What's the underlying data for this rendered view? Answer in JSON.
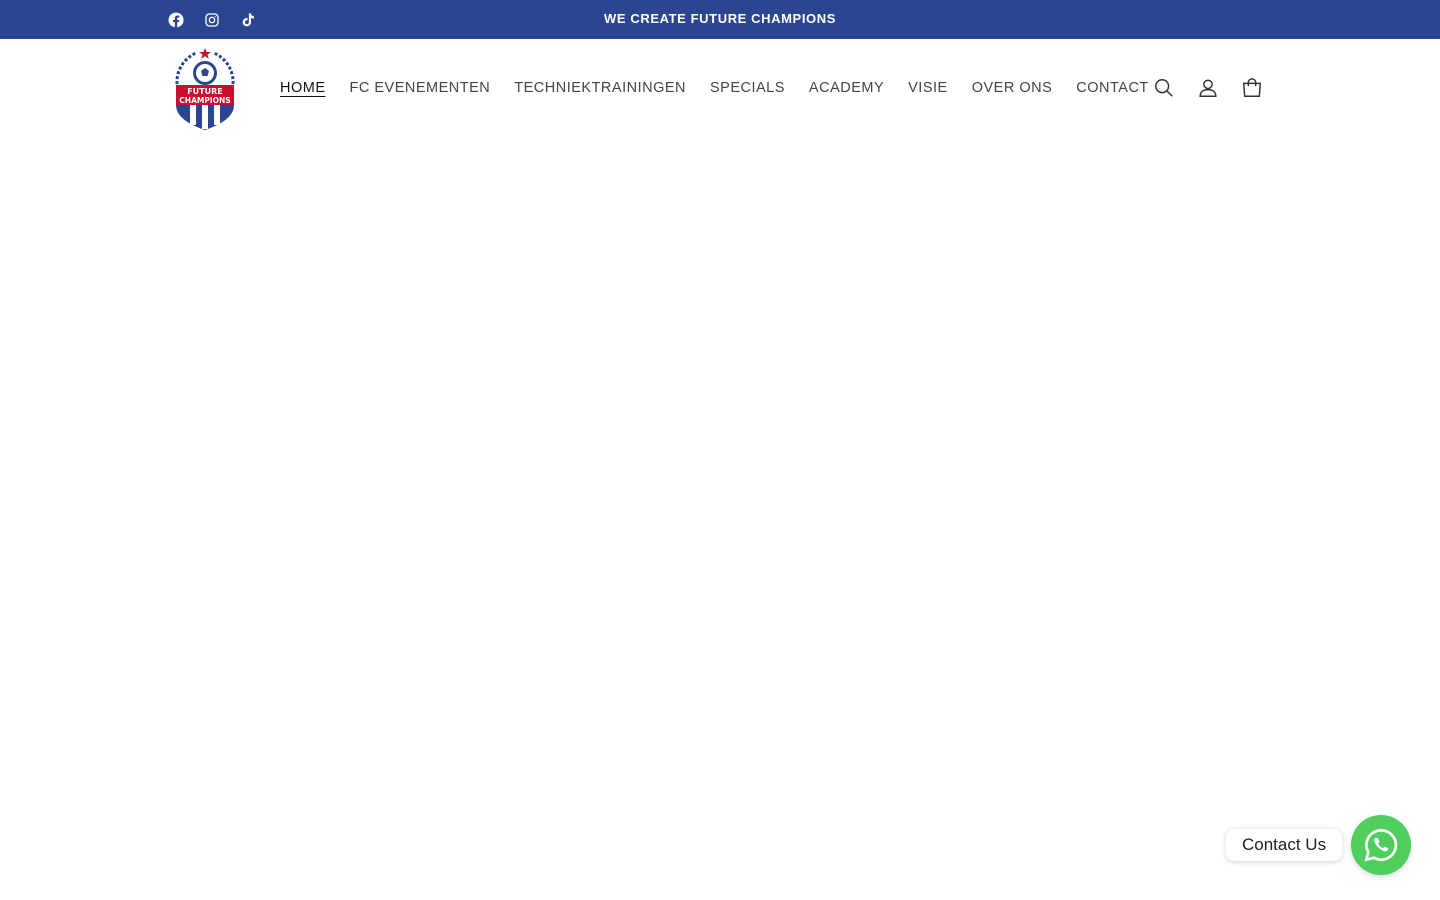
{
  "announcement": {
    "text": "WE CREATE FUTURE CHAMPIONS",
    "social_icons": [
      "facebook-icon",
      "instagram-icon",
      "tiktok-icon"
    ]
  },
  "header": {
    "logo": {
      "line1": "FUTURE",
      "line2": "CHAMPIONS"
    },
    "nav": [
      {
        "label": "HOME",
        "active": true
      },
      {
        "label": "FC EVENEMENTEN",
        "active": false
      },
      {
        "label": "TECHNIEKTRAININGEN",
        "active": false
      },
      {
        "label": "SPECIALS",
        "active": false
      },
      {
        "label": "ACADEMY",
        "active": false
      },
      {
        "label": "VISIE",
        "active": false
      },
      {
        "label": "OVER ONS",
        "active": false
      },
      {
        "label": "CONTACT",
        "active": false
      }
    ],
    "icons": [
      "search-icon",
      "account-icon",
      "cart-icon"
    ]
  },
  "contact_widget": {
    "label": "Contact Us",
    "icon": "whatsapp-icon"
  },
  "colors": {
    "brand_blue": "#2b4590",
    "brand_red": "#c8102e",
    "whatsapp_green": "#4fce5d"
  }
}
